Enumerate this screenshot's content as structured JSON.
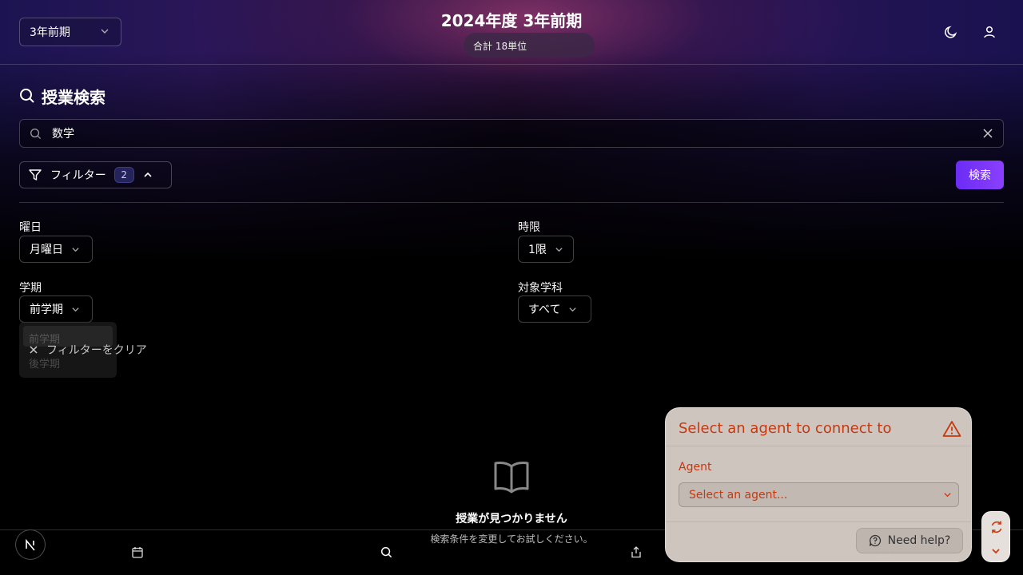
{
  "header": {
    "term_select": "3年前期",
    "title": "2024年度 3年前期",
    "credits": "合計 18単位"
  },
  "search": {
    "section_title": "授業検索",
    "query": "数学",
    "filter_label": "フィルター",
    "filter_count": "2",
    "search_button": "検索"
  },
  "filters": {
    "day_label": "曜日",
    "day_value": "月曜日",
    "period_label": "時限",
    "period_value": "1限",
    "semester_label": "学期",
    "semester_value": "前学期",
    "semester_options": [
      "前学期",
      "後学期"
    ],
    "department_label": "対象学科",
    "department_value": "すべて",
    "clear_label": "フィルターをクリア"
  },
  "empty_state": {
    "title": "授業が見つかりません",
    "subtitle": "検索条件を変更してお試しください。"
  },
  "agent_panel": {
    "title": "Select an agent to connect to",
    "agent_label": "Agent",
    "agent_placeholder": "Select an agent...",
    "help_label": "Need help?"
  },
  "colors": {
    "accent": "#7c3aed",
    "agent_text": "#cc3a10",
    "panel_bg": "#d3c9c3"
  }
}
